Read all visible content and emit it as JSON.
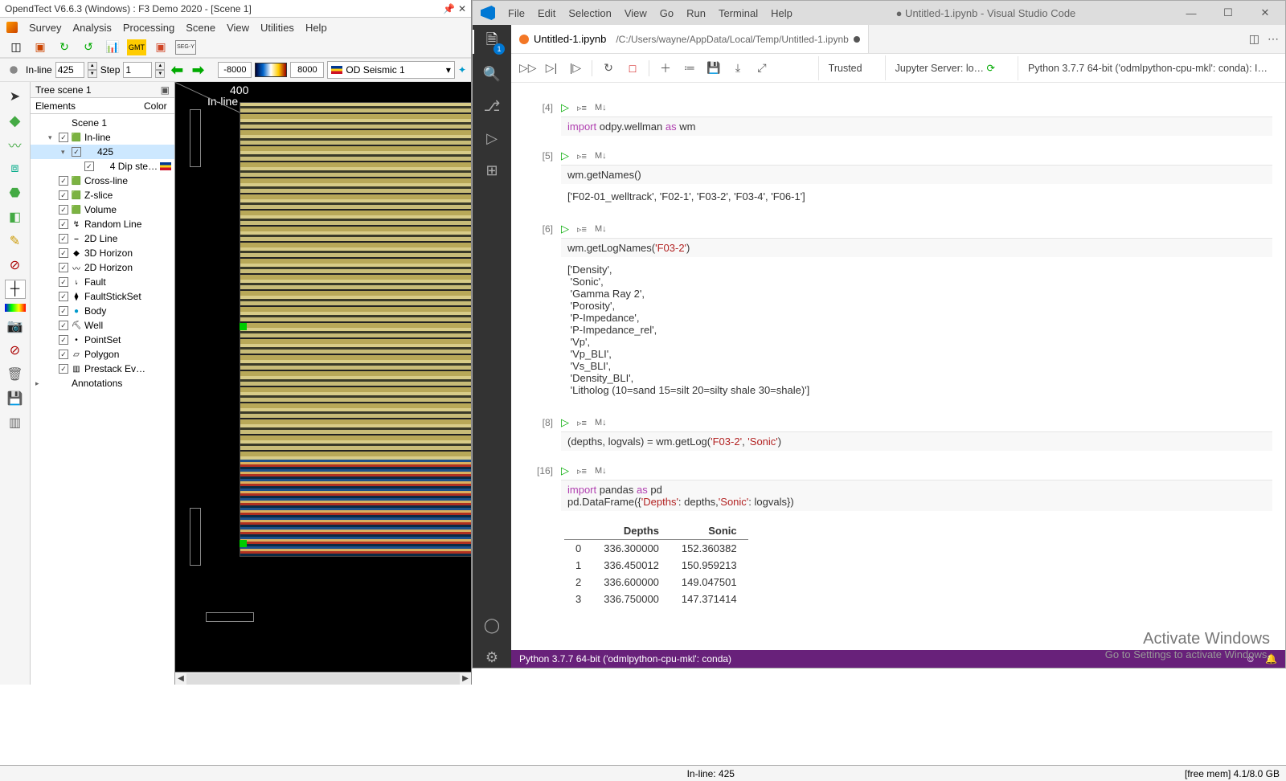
{
  "opendtect": {
    "title": "OpendTect V6.6.3 (Windows) : F3 Demo 2020 - [Scene 1]",
    "menu": [
      "Survey",
      "Analysis",
      "Processing",
      "Scene",
      "View",
      "Utilities",
      "Help"
    ],
    "tool2": {
      "inline_label": "In-line",
      "inline_val": "425",
      "step_label": "Step",
      "step_val": "1",
      "range_min": "-8000",
      "range_max": "8000",
      "seismic_label": "OD Seismic 1"
    },
    "tree_title": "Tree scene 1",
    "tree_cols": [
      "Elements",
      "Color"
    ],
    "tree": [
      {
        "indent": 0,
        "exp": "",
        "chk": false,
        "icon": "",
        "label": "Scene 1"
      },
      {
        "indent": 1,
        "exp": "▾",
        "chk": true,
        "icon": "🟩",
        "label": "In-line"
      },
      {
        "indent": 2,
        "exp": "▾",
        "chk": true,
        "icon": "",
        "label": "425",
        "sel": true
      },
      {
        "indent": 3,
        "exp": "",
        "chk": true,
        "icon": "",
        "label": "4 Dip ste…",
        "flag": true
      },
      {
        "indent": 1,
        "exp": "",
        "chk": true,
        "icon": "🟩",
        "label": "Cross-line"
      },
      {
        "indent": 1,
        "exp": "",
        "chk": true,
        "icon": "🟩",
        "label": "Z-slice"
      },
      {
        "indent": 1,
        "exp": "",
        "chk": true,
        "icon": "🟩",
        "label": "Volume"
      },
      {
        "indent": 1,
        "exp": "",
        "chk": true,
        "icon": "↯",
        "label": "Random Line"
      },
      {
        "indent": 1,
        "exp": "",
        "chk": true,
        "icon": "⎯",
        "label": "2D Line"
      },
      {
        "indent": 1,
        "exp": "",
        "chk": true,
        "icon": "◆",
        "label": "3D Horizon"
      },
      {
        "indent": 1,
        "exp": "",
        "chk": true,
        "icon": "〰",
        "label": "2D Horizon"
      },
      {
        "indent": 1,
        "exp": "",
        "chk": true,
        "icon": "⭏",
        "label": "Fault"
      },
      {
        "indent": 1,
        "exp": "",
        "chk": true,
        "icon": "⧫",
        "label": "FaultStickSet"
      },
      {
        "indent": 1,
        "exp": "",
        "chk": true,
        "icon": "●",
        "label": "Body",
        "blue": true
      },
      {
        "indent": 1,
        "exp": "",
        "chk": true,
        "icon": "⛏",
        "label": "Well"
      },
      {
        "indent": 1,
        "exp": "",
        "chk": true,
        "icon": "•",
        "label": "PointSet"
      },
      {
        "indent": 1,
        "exp": "",
        "chk": true,
        "icon": "▱",
        "label": "Polygon"
      },
      {
        "indent": 1,
        "exp": "",
        "chk": true,
        "icon": "▥",
        "label": "Prestack Ev…"
      },
      {
        "indent": 0,
        "exp": "▸",
        "chk": false,
        "icon": "",
        "label": "Annotations"
      }
    ],
    "viewer": {
      "top_label": "400",
      "axis_label": "In-line"
    },
    "status_left": "",
    "status_center": "In-line: 425",
    "status_right": "[free mem] 4.1/8.0 GB"
  },
  "vscode": {
    "menu": [
      "File",
      "Edit",
      "Selection",
      "View",
      "Go",
      "Run",
      "Terminal",
      "Help"
    ],
    "doc_title": "● Untitled-1.ipynb - Visual Studio Code",
    "tab_name": "Untitled-1.ipynb",
    "breadcrumb": "/C:/Users/wayne/AppData/Local/Temp/Untitled-1.ipynb",
    "nb_status": {
      "trusted": "Trusted",
      "server": "Jupyter Server: lo…",
      "kernel": "Python 3.7.7 64-bit ('odmlpython-cpu-mkl': conda): I…"
    },
    "cells": [
      {
        "num": "[4]",
        "code_html": "<span class='kw'>import</span> odpy.wellman <span class='kw'>as</span> wm"
      },
      {
        "num": "[5]",
        "code_html": "wm.getNames()",
        "out": "['F02-01_welltrack', 'F02-1', 'F03-2', 'F03-4', 'F06-1']"
      },
      {
        "num": "[6]",
        "code_html": "wm.getLogNames(<span class='str'>'F03-2'</span>)",
        "out": "['Density',\n 'Sonic',\n 'Gamma Ray 2',\n 'Porosity',\n 'P-Impedance',\n 'P-Impedance_rel',\n 'Vp',\n 'Vp_BLI',\n 'Vs_BLI',\n 'Density_BLI',\n 'Litholog (10=sand 15=silt 20=silty shale 30=shale)']"
      },
      {
        "num": "[8]",
        "code_html": "(depths, logvals) = wm.getLog(<span class='str'>'F03-2'</span>, <span class='str'>'Sonic'</span>)"
      },
      {
        "num": "[16]",
        "code_html": "<span class='kw'>import</span> pandas <span class='kw'>as</span> pd\npd.DataFrame({<span class='str'>'Depths'</span>: depths,<span class='str'>'Sonic'</span>: logvals})"
      }
    ],
    "table": {
      "cols": [
        "",
        "Depths",
        "Sonic"
      ],
      "rows": [
        [
          "0",
          "336.300000",
          "152.360382"
        ],
        [
          "1",
          "336.450012",
          "150.959213"
        ],
        [
          "2",
          "336.600000",
          "149.047501"
        ],
        [
          "3",
          "336.750000",
          "147.371414"
        ]
      ]
    },
    "statusbar": "Python 3.7.7 64-bit ('odmlpython-cpu-mkl': conda)"
  },
  "watermark": {
    "l1": "Activate Windows",
    "l2": "Go to Settings to activate Windows."
  }
}
